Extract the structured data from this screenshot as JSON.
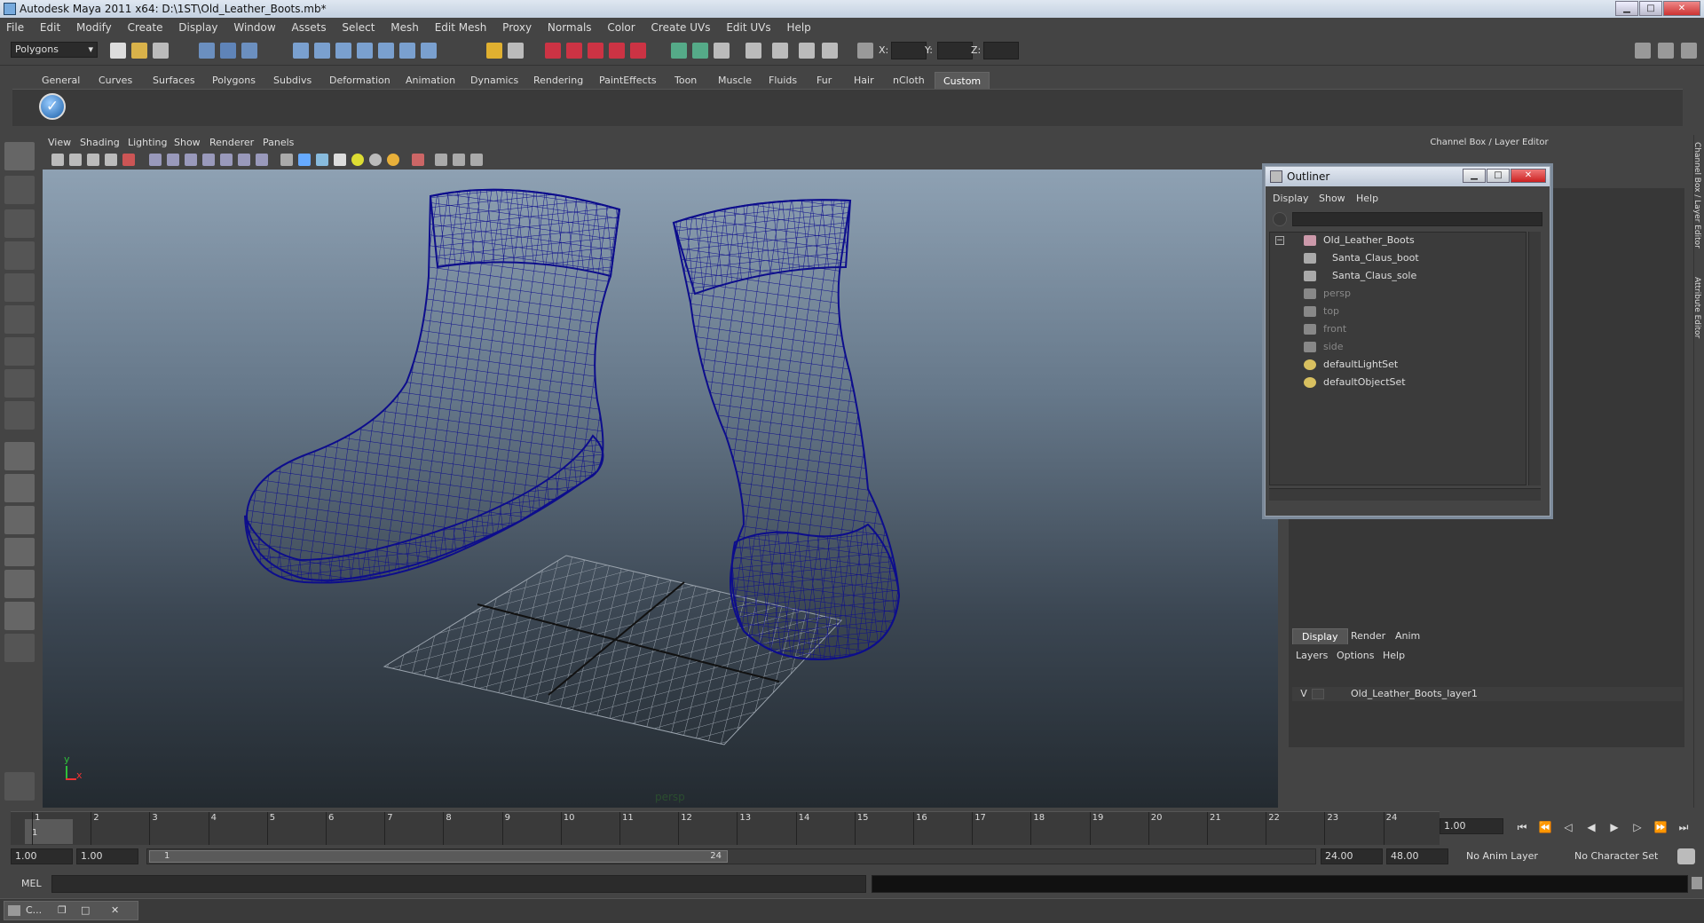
{
  "window": {
    "title": "Autodesk Maya 2011 x64: D:\\1ST\\Old_Leather_Boots.mb*"
  },
  "menubar": [
    "File",
    "Edit",
    "Modify",
    "Create",
    "Display",
    "Window",
    "Assets",
    "Select",
    "Mesh",
    "Edit Mesh",
    "Proxy",
    "Normals",
    "Color",
    "Create UVs",
    "Edit UVs",
    "Help"
  ],
  "toolbar": {
    "mode": "Polygons",
    "x_label": "X:",
    "y_label": "Y:",
    "z_label": "Z:"
  },
  "shelf_tabs": [
    "General",
    "Curves",
    "Surfaces",
    "Polygons",
    "Subdivs",
    "Deformation",
    "Animation",
    "Dynamics",
    "Rendering",
    "PaintEffects",
    "Toon",
    "Muscle",
    "Fluids",
    "Fur",
    "Hair",
    "nCloth",
    "Custom"
  ],
  "shelf_active": "Custom",
  "panel_menu": [
    "View",
    "Shading",
    "Lighting",
    "Show",
    "Renderer",
    "Panels"
  ],
  "viewport": {
    "camera": "persp",
    "axis_y": "y",
    "axis_x": "x"
  },
  "channel_box": {
    "title": "Channel Box / Layer Editor"
  },
  "side_tabs": {
    "channel_box": "Channel Box / Layer Editor",
    "attribute_editor": "Attribute Editor"
  },
  "outliner": {
    "title": "Outliner",
    "menu": [
      "Display",
      "Show",
      "Help"
    ],
    "items": [
      {
        "label": "Old_Leather_Boots",
        "icon": "transform-icon",
        "dim": false
      },
      {
        "label": "Santa_Claus_boot",
        "icon": "mesh-icon",
        "dim": false
      },
      {
        "label": "Santa_Claus_sole",
        "icon": "mesh-icon",
        "dim": false
      },
      {
        "label": "persp",
        "icon": "camera-icon",
        "dim": true
      },
      {
        "label": "top",
        "icon": "camera-icon",
        "dim": true
      },
      {
        "label": "front",
        "icon": "camera-icon",
        "dim": true
      },
      {
        "label": "side",
        "icon": "camera-icon",
        "dim": true
      },
      {
        "label": "defaultLightSet",
        "icon": "set-icon",
        "dim": false
      },
      {
        "label": "defaultObjectSet",
        "icon": "set-icon",
        "dim": false
      }
    ]
  },
  "layer_editor": {
    "tabs": [
      "Display",
      "Render",
      "Anim"
    ],
    "active_tab": "Display",
    "menu": [
      "Layers",
      "Options",
      "Help"
    ],
    "layers": [
      {
        "visible": "V",
        "name": "Old_Leather_Boots_layer1"
      }
    ]
  },
  "time_slider": {
    "frames": [
      "1",
      "2",
      "3",
      "4",
      "5",
      "6",
      "7",
      "8",
      "9",
      "10",
      "11",
      "12",
      "13",
      "14",
      "15",
      "16",
      "17",
      "18",
      "19",
      "20",
      "21",
      "22",
      "23",
      "24"
    ],
    "current_frame_marker": "1",
    "current_time": "1.00"
  },
  "range": {
    "start": "1.00",
    "playback_start": "1.00",
    "slider_start": "1",
    "slider_end": "24",
    "playback_end": "24.00",
    "end": "48.00",
    "anim_layer": "No Anim Layer",
    "character_set": "No Character Set"
  },
  "command_line": {
    "label": "MEL"
  },
  "taskbar": {
    "label": "C..."
  },
  "colors": {
    "wire": "#0d0d8c",
    "bg": "#444444",
    "accent": "#5a5a5a"
  }
}
